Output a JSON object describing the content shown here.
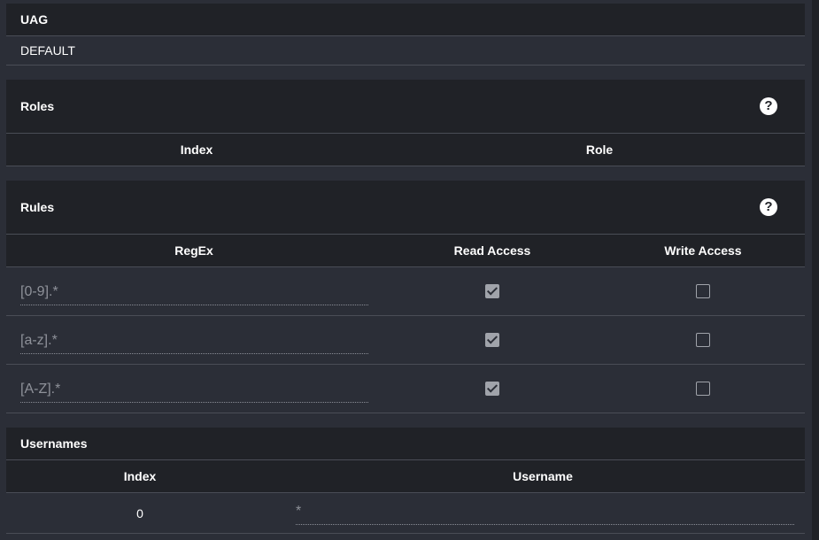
{
  "uag": {
    "title": "UAG",
    "value": "DEFAULT"
  },
  "roles": {
    "title": "Roles",
    "help_icon": "help-circle-icon",
    "columns": [
      "Index",
      "Role"
    ]
  },
  "rules": {
    "title": "Rules",
    "help_icon": "help-circle-icon",
    "columns": [
      "RegEx",
      "Read Access",
      "Write Access"
    ],
    "rows": [
      {
        "regex": "[0-9].*",
        "read": true,
        "write": false
      },
      {
        "regex": "[a-z].*",
        "read": true,
        "write": false
      },
      {
        "regex": "[A-Z].*",
        "read": true,
        "write": false
      }
    ]
  },
  "usernames": {
    "title": "Usernames",
    "columns": [
      "Index",
      "Username"
    ],
    "rows": [
      {
        "index": "0",
        "username": "*"
      }
    ]
  }
}
